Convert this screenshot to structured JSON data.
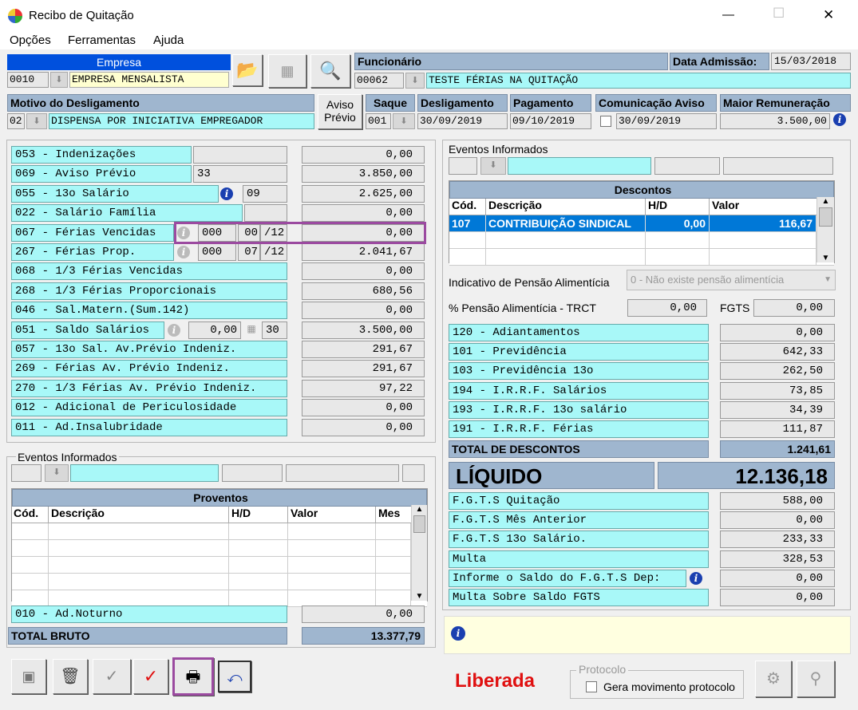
{
  "window": {
    "title": "Recibo de Quitação",
    "min": "—",
    "max": "☐",
    "close": "✕"
  },
  "menu": [
    "Opções",
    "Ferramentas",
    "Ajuda"
  ],
  "empresa": {
    "label": "Empresa",
    "code": "0010",
    "name": "EMPRESA MENSALISTA"
  },
  "funcionario": {
    "label": "Funcionário",
    "code": "00062",
    "name": "TESTE FÉRIAS NA QUITAÇÃO"
  },
  "admissao": {
    "label": "Data Admissão:",
    "value": "15/03/2018"
  },
  "motivo": {
    "label": "Motivo do Desligamento",
    "code": "02",
    "name": "DISPENSA POR INICIATIVA EMPREGADOR"
  },
  "aviso": {
    "line1": "Aviso",
    "line2": "Prévio"
  },
  "saque": {
    "label": "Saque",
    "value": "001"
  },
  "desligamento": {
    "label": "Desligamento",
    "value": "30/09/2019"
  },
  "pagamento": {
    "label": "Pagamento",
    "value": "09/10/2019"
  },
  "comunicacao": {
    "label": "Comunicação Aviso",
    "value": "30/09/2019"
  },
  "maior": {
    "label": "Maior Remuneração",
    "value": "3.500,00"
  },
  "proventos_rows": [
    {
      "label": "053 - Indenizações",
      "value": "0,00"
    },
    {
      "label": "069 - Aviso Prévio",
      "extra": "33",
      "value": "3.850,00"
    },
    {
      "label": "055 - 13o Salário",
      "extra": "09",
      "value": "2.625,00"
    },
    {
      "label": "022 - Salário Família",
      "value": "0,00"
    },
    {
      "label": "067 - Férias Vencidas",
      "a": "000",
      "b": "00",
      "c": "/12",
      "value": "0,00"
    },
    {
      "label": "267 - Férias Prop.",
      "a": "000",
      "b": "07",
      "c": "/12",
      "value": "2.041,67"
    },
    {
      "label": "068 - 1/3 Férias Vencidas",
      "value": "0,00"
    },
    {
      "label": "268 - 1/3 Férias Proporcionais",
      "value": "680,56"
    },
    {
      "label": "046 - Sal.Matern.(Sum.142)",
      "value": "0,00"
    },
    {
      "label": "051 - Saldo Salários",
      "a": "0,00",
      "b": "30",
      "value": "3.500,00"
    },
    {
      "label": "057 - 13o Sal. Av.Prévio Indeniz.",
      "value": "291,67"
    },
    {
      "label": "269 -  Férias  Av. Prévio Indeniz.",
      "value": "291,67"
    },
    {
      "label": "270 -  1/3 Férias Av. Prévio Indeniz.",
      "value": "97,22"
    },
    {
      "label": "012 - Adicional de Periculosidade",
      "value": "0,00"
    },
    {
      "label": "011 - Ad.Insalubridade",
      "value": "0,00"
    }
  ],
  "eventos_left": {
    "label": "Eventos Informados",
    "table_title": "Proventos",
    "cols": [
      "Cód.",
      "Descrição",
      "H/D",
      "Valor",
      "Mes"
    ]
  },
  "ad_noturno": {
    "label": "010 - Ad.Noturno",
    "value": "0,00"
  },
  "total_bruto": {
    "label": "TOTAL BRUTO",
    "value": "13.377,79"
  },
  "eventos_right": {
    "label": "Eventos Informados",
    "table_title": "Descontos",
    "cols": [
      "Cód.",
      "Descrição",
      "H/D",
      "Valor"
    ],
    "row": {
      "cod": "107",
      "desc": "CONTRIBUIÇÃO SINDICAL",
      "hd": "0,00",
      "valor": "116,67"
    }
  },
  "pensao": {
    "label": "Indicativo de Pensão Alimentícia",
    "value": "0 - Não existe pensão alimentícia"
  },
  "pct_pensao": {
    "label": "% Pensão Alimentícia - TRCT",
    "value": "0,00"
  },
  "fgts": {
    "label": "FGTS",
    "value": "0,00"
  },
  "descontos_rows": [
    {
      "label": "120 - Adiantamentos",
      "value": "0,00"
    },
    {
      "label": "101 - Previdência",
      "value": "642,33"
    },
    {
      "label": "103 - Previdência 13o",
      "value": "262,50"
    },
    {
      "label": "194 - I.R.R.F. Salários",
      "value": "73,85"
    },
    {
      "label": "193 - I.R.R.F. 13o salário",
      "value": "34,39"
    },
    {
      "label": "191 - I.R.R.F. Férias",
      "value": "111,87"
    }
  ],
  "total_descontos": {
    "label": "TOTAL DE DESCONTOS",
    "value": "1.241,61"
  },
  "liquido": {
    "label": "LÍQUIDO",
    "value": "12.136,18"
  },
  "fgts_rows": [
    {
      "label": "F.G.T.S  Quitação",
      "value": "588,00"
    },
    {
      "label": "F.G.T.S  Mês Anterior",
      "value": "0,00"
    },
    {
      "label": "F.G.T.S  13o Salário.",
      "value": "233,33"
    },
    {
      "label": "Multa",
      "value": "328,53"
    },
    {
      "label": "Informe o Saldo do F.G.T.S Dep:",
      "value": "0,00"
    },
    {
      "label": "Multa Sobre Saldo FGTS",
      "value": "0,00"
    }
  ],
  "status": {
    "text": "Liberada",
    "color": "#e01010"
  },
  "protocolo": {
    "legend": "Protocolo",
    "check": "Gera movimento protocolo"
  }
}
